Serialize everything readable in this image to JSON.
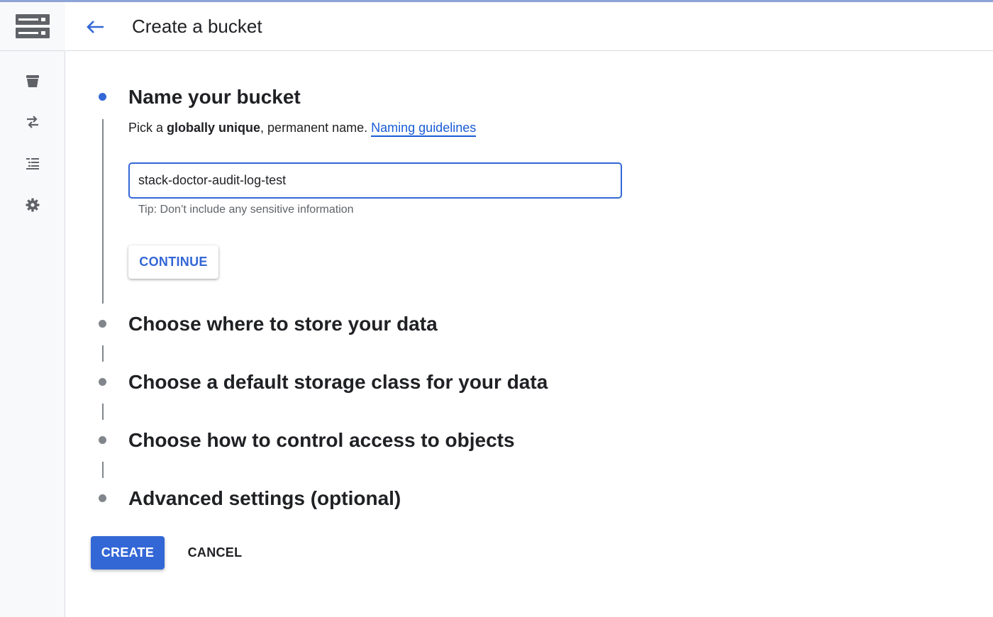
{
  "header": {
    "title": "Create a bucket",
    "back_icon": "arrow-back-icon"
  },
  "sidebar": {
    "logo_icon": "storage-logo-icon",
    "items": [
      {
        "icon": "bucket-icon"
      },
      {
        "icon": "transfer-icon"
      },
      {
        "icon": "list-icon"
      },
      {
        "icon": "gear-icon"
      }
    ]
  },
  "steps": [
    {
      "title": "Name your bucket",
      "active": true
    },
    {
      "title": "Choose where to store your data",
      "active": false
    },
    {
      "title": "Choose a default storage class for your data",
      "active": false
    },
    {
      "title": "Choose how to control access to objects",
      "active": false
    },
    {
      "title": "Advanced settings (optional)",
      "active": false
    }
  ],
  "name_step": {
    "desc_prefix": "Pick a ",
    "desc_bold": "globally unique",
    "desc_suffix": ", permanent name. ",
    "link_text": "Naming guidelines",
    "input_value": "stack-doctor-audit-log-test",
    "tip": "Tip: Don’t include any sensitive information",
    "continue_label": "CONTINUE"
  },
  "actions": {
    "create_label": "CREATE",
    "cancel_label": "CANCEL"
  },
  "colors": {
    "accent": "#3367d6",
    "link": "#1a5bd6",
    "muted": "#80868b"
  }
}
